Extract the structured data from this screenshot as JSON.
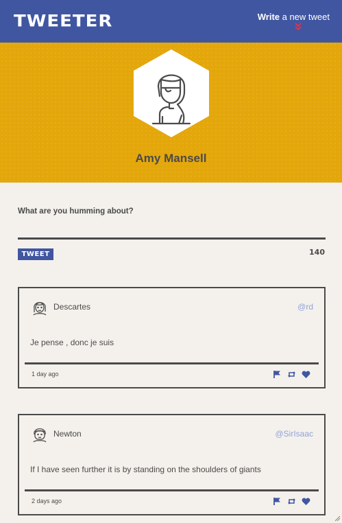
{
  "nav": {
    "brand": "TWEETER",
    "write_bold": "Write",
    "write_rest": " a new tweet"
  },
  "profile": {
    "name": "Amy Mansell"
  },
  "compose": {
    "label": "What are you humming about?",
    "button_label": "TWEET",
    "counter": "140"
  },
  "tweets": [
    {
      "name": "Descartes",
      "handle": "@rd",
      "body": "Je pense , donc je suis",
      "time": "1 day ago"
    },
    {
      "name": "Newton",
      "handle": "@SirIsaac",
      "body": "If I have seen further it is by standing on the shoulders of giants",
      "time": "2 days ago"
    }
  ],
  "colors": {
    "nav_bg": "#4056a1",
    "profile_bg": "#e4a70b",
    "page_bg": "#f4f1ec",
    "text": "#4a4a4a",
    "handle": "#8fa3d9",
    "chevron": "#e0334c"
  },
  "icons": [
    "chevron-down-icon",
    "user-avatar-icon",
    "flag-icon",
    "retweet-icon",
    "heart-icon"
  ]
}
